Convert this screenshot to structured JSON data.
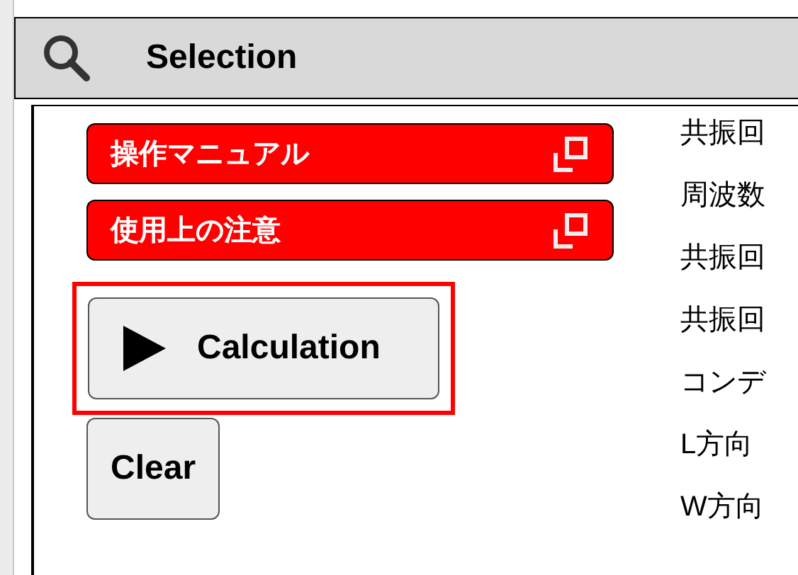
{
  "header": {
    "title": "Selection"
  },
  "links": [
    {
      "label": "操作マニュアル"
    },
    {
      "label": "使用上の注意"
    }
  ],
  "buttons": [
    {
      "kind": "play",
      "label": "Calculation",
      "highlighted": true
    },
    {
      "kind": "plain",
      "label": "Clear",
      "highlighted": false
    }
  ],
  "items": [
    "共振回",
    "周波数",
    "共振回",
    "共振回",
    "コンデ",
    "L方向",
    "W方向"
  ]
}
